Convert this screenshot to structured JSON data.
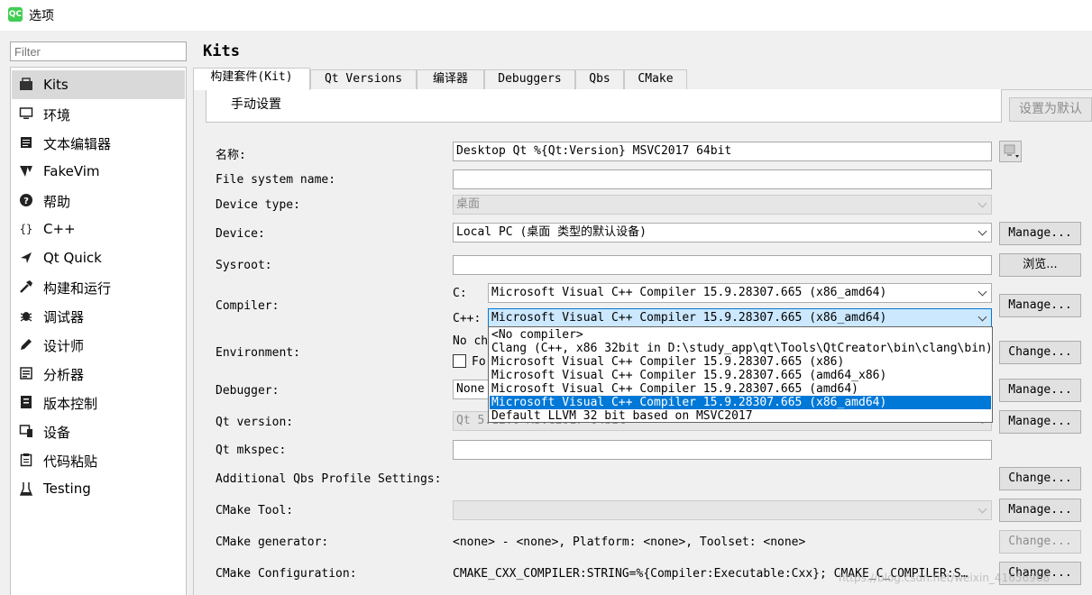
{
  "window": {
    "title": "选项",
    "app_icon": "QC"
  },
  "sidebar": {
    "filter_placeholder": "Filter",
    "items": [
      {
        "label": "Kits",
        "icon": "kits-icon",
        "selected": true
      },
      {
        "label": "环境",
        "icon": "monitor-icon"
      },
      {
        "label": "文本编辑器",
        "icon": "text-editor-icon"
      },
      {
        "label": "FakeVim",
        "icon": "fakevim-icon"
      },
      {
        "label": "帮助",
        "icon": "help-icon"
      },
      {
        "label": "C++",
        "icon": "braces-icon"
      },
      {
        "label": "Qt Quick",
        "icon": "qt-quick-icon"
      },
      {
        "label": "构建和运行",
        "icon": "hammer-icon"
      },
      {
        "label": "调试器",
        "icon": "bug-icon"
      },
      {
        "label": "设计师",
        "icon": "pen-icon"
      },
      {
        "label": "分析器",
        "icon": "analyzer-icon"
      },
      {
        "label": "版本控制",
        "icon": "version-control-icon"
      },
      {
        "label": "设备",
        "icon": "device-icon"
      },
      {
        "label": "代码粘贴",
        "icon": "clipboard-icon"
      },
      {
        "label": "Testing",
        "icon": "flask-icon"
      }
    ]
  },
  "main": {
    "heading": "Kits",
    "tabs": [
      "构建套件(Kit)",
      "Qt Versions",
      "编译器",
      "Debuggers",
      "Qbs",
      "CMake"
    ],
    "kit_list_label": "手动设置",
    "make_default_button": "设置为默认",
    "form": {
      "name_label": "名称:",
      "name_value": "Desktop Qt %{Qt:Version} MSVC2017 64bit",
      "fs_name_label": "File system name:",
      "fs_name_value": "",
      "device_type_label": "Device type:",
      "device_type_value": "桌面",
      "device_label": "Device:",
      "device_value": "Local PC (桌面 类型的默认设备)",
      "device_button": "Manage...",
      "sysroot_label": "Sysroot:",
      "sysroot_value": "",
      "sysroot_button": "浏览...",
      "compiler_label": "Compiler:",
      "compiler_c_label": "C:",
      "compiler_c_value": "Microsoft Visual C++ Compiler 15.9.28307.665 (x86_amd64)",
      "compiler_cxx_label": "C++:",
      "compiler_cxx_value": "Microsoft Visual C++ Compiler 15.9.28307.665 (x86_amd64)",
      "compiler_button": "Manage...",
      "environment_label": "Environment:",
      "environment_text": "No ch",
      "environment_checkbox_label": "Fo",
      "environment_button": "Change...",
      "debugger_label": "Debugger:",
      "debugger_value": "None",
      "debugger_button": "Manage...",
      "qt_version_label": "Qt version:",
      "qt_version_value": "Qt 5.12.0 MSVC2017 64bit",
      "qt_version_button": "Manage...",
      "qt_mkspec_label": "Qt mkspec:",
      "qt_mkspec_value": "",
      "qbs_label": "Additional Qbs Profile Settings:",
      "qbs_button": "Change...",
      "cmake_tool_label": "CMake Tool:",
      "cmake_tool_value": "",
      "cmake_tool_button": "Manage...",
      "cmake_generator_label": "CMake generator:",
      "cmake_generator_value": "<none> - <none>, Platform: <none>, Toolset: <none>",
      "cmake_generator_button": "Change...",
      "cmake_config_label": "CMake Configuration:",
      "cmake_config_value": "CMAKE_CXX_COMPILER:STRING=%{Compiler:Executable:Cxx}; CMAKE_C_COMPILER:S…",
      "cmake_config_button": "Change..."
    },
    "compiler_dropdown": {
      "options": [
        "<No compiler>",
        "Clang (C++, x86 32bit in D:\\study_app\\qt\\Tools\\QtCreator\\bin\\clang\\bin)",
        "Microsoft Visual C++ Compiler 15.9.28307.665 (x86)",
        "Microsoft Visual C++ Compiler 15.9.28307.665 (amd64_x86)",
        "Microsoft Visual C++ Compiler 15.9.28307.665 (amd64)",
        "Microsoft Visual C++ Compiler 15.9.28307.665 (x86_amd64)",
        "Default LLVM 32 bit based on MSVC2017"
      ],
      "selected_index": 5
    }
  },
  "watermark": "https://blog.csdn.net/weixin_41656968"
}
